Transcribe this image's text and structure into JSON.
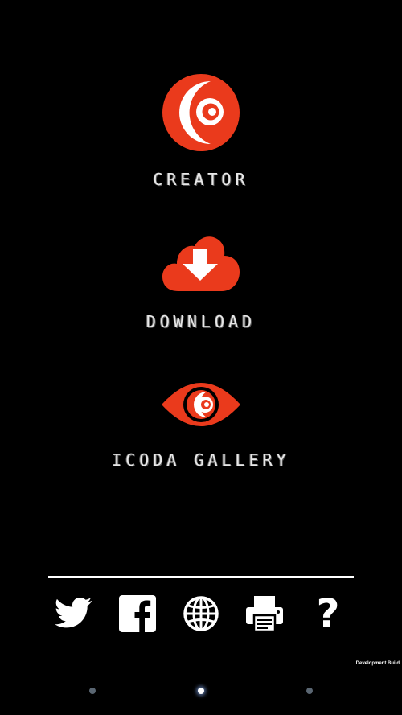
{
  "menu": {
    "creator_label": "CREATOR",
    "download_label": "DOWNLOAD",
    "gallery_label": "ICODA GALLERY"
  },
  "social": {
    "twitter_icon": "twitter-bird-icon",
    "facebook_icon": "facebook-icon",
    "web_icon": "globe-icon",
    "print_icon": "printer-icon",
    "help_symbol": "?"
  },
  "footer": {
    "build_text": "Development Build"
  },
  "pager": {
    "page_count": 3,
    "active_page": 2
  },
  "colors": {
    "background": "#000000",
    "accent": "#ea3a1c",
    "text": "#ffffff",
    "inactive_dot": "#5a6672"
  }
}
